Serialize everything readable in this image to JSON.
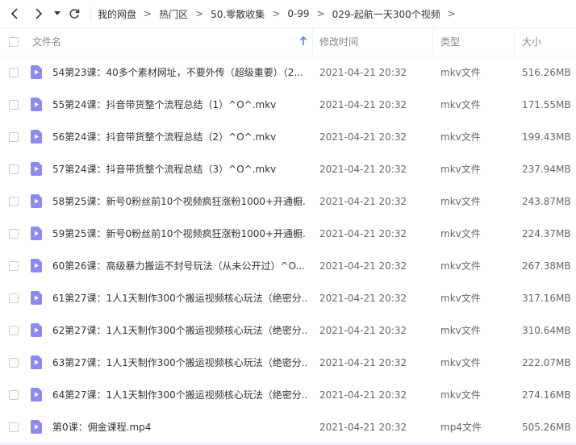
{
  "toolbar": {
    "back_icon": "chevron-left-icon",
    "forward_icon": "chevron-right-icon",
    "history_icon": "caret-down-icon",
    "refresh_icon": "refresh-icon"
  },
  "breadcrumb": [
    "我的网盘",
    "热门区",
    "50.零散收集",
    "0-99",
    "029-起航一天300个视频"
  ],
  "columns": {
    "name": "文件名",
    "modified": "修改时间",
    "type": "类型",
    "size": "大小"
  },
  "files": [
    {
      "name": "54第23课：40多个素材网址，不要外传（超级重要）（2...",
      "modified": "2021-04-21 20:32",
      "type": "mkv文件",
      "size": "516.26MB"
    },
    {
      "name": "55第24课：抖音带货整个流程总结（1）^O^.mkv",
      "modified": "2021-04-21 20:32",
      "type": "mkv文件",
      "size": "171.55MB"
    },
    {
      "name": "56第24课：抖音带货整个流程总结（2）^O^.mkv",
      "modified": "2021-04-21 20:32",
      "type": "mkv文件",
      "size": "199.43MB"
    },
    {
      "name": "57第24课：抖音带货整个流程总结（3）^O^.mkv",
      "modified": "2021-04-21 20:32",
      "type": "mkv文件",
      "size": "237.94MB"
    },
    {
      "name": "58第25课：新号0粉丝前10个视频疯狂涨粉1000+开通橱...",
      "modified": "2021-04-21 20:32",
      "type": "mkv文件",
      "size": "243.87MB"
    },
    {
      "name": "59第25课：新号0粉丝前10个视频疯狂涨粉1000+开通橱...",
      "modified": "2021-04-21 20:32",
      "type": "mkv文件",
      "size": "224.37MB"
    },
    {
      "name": "60第26课：高级暴力搬运不封号玩法（从未公开过）^O...",
      "modified": "2021-04-21 20:32",
      "type": "mkv文件",
      "size": "267.38MB"
    },
    {
      "name": "61第27课：1人1天制作300个搬运视频核心玩法（绝密分...",
      "modified": "2021-04-21 20:32",
      "type": "mkv文件",
      "size": "317.16MB"
    },
    {
      "name": "62第27课：1人1天制作300个搬运视频核心玩法（绝密分...",
      "modified": "2021-04-21 20:32",
      "type": "mkv文件",
      "size": "310.64MB"
    },
    {
      "name": "63第27课：1人1天制作300个搬运视频核心玩法（绝密分...",
      "modified": "2021-04-21 20:32",
      "type": "mkv文件",
      "size": "222.07MB"
    },
    {
      "name": "64第27课：1人1天制作300个搬运视频核心玩法（绝密分...",
      "modified": "2021-04-21 20:32",
      "type": "mkv文件",
      "size": "274.16MB"
    },
    {
      "name": "第0课：佣金课程.mp4",
      "modified": "2021-04-21 20:32",
      "type": "mp4文件",
      "size": "505.26MB"
    }
  ],
  "colors": {
    "file_icon": "#8d88f3",
    "sort_arrow": "#3b8cff"
  }
}
